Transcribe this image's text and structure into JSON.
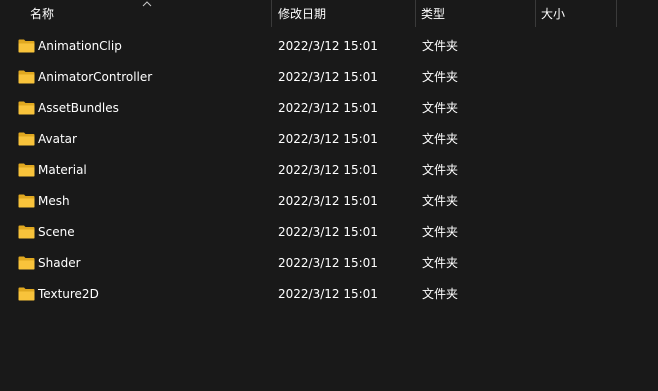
{
  "columns": {
    "name": "名称",
    "modified": "修改日期",
    "type": "类型",
    "size": "大小"
  },
  "sort": {
    "column": "name",
    "direction": "ascending",
    "icon": "chevron-up-icon"
  },
  "colors": {
    "background": "#191919",
    "folder": "#f8c33b",
    "folder_back": "#e0a820",
    "text": "#ffffff"
  },
  "rows": [
    {
      "icon": "folder-icon",
      "name": "AnimationClip",
      "modified": "2022/3/12 15:01",
      "type": "文件夹",
      "size": ""
    },
    {
      "icon": "folder-icon",
      "name": "AnimatorController",
      "modified": "2022/3/12 15:01",
      "type": "文件夹",
      "size": ""
    },
    {
      "icon": "folder-icon",
      "name": "AssetBundles",
      "modified": "2022/3/12 15:01",
      "type": "文件夹",
      "size": ""
    },
    {
      "icon": "folder-icon",
      "name": "Avatar",
      "modified": "2022/3/12 15:01",
      "type": "文件夹",
      "size": ""
    },
    {
      "icon": "folder-icon",
      "name": "Material",
      "modified": "2022/3/12 15:01",
      "type": "文件夹",
      "size": ""
    },
    {
      "icon": "folder-icon",
      "name": "Mesh",
      "modified": "2022/3/12 15:01",
      "type": "文件夹",
      "size": ""
    },
    {
      "icon": "folder-icon",
      "name": "Scene",
      "modified": "2022/3/12 15:01",
      "type": "文件夹",
      "size": ""
    },
    {
      "icon": "folder-icon",
      "name": "Shader",
      "modified": "2022/3/12 15:01",
      "type": "文件夹",
      "size": ""
    },
    {
      "icon": "folder-icon",
      "name": "Texture2D",
      "modified": "2022/3/12 15:01",
      "type": "文件夹",
      "size": ""
    }
  ]
}
